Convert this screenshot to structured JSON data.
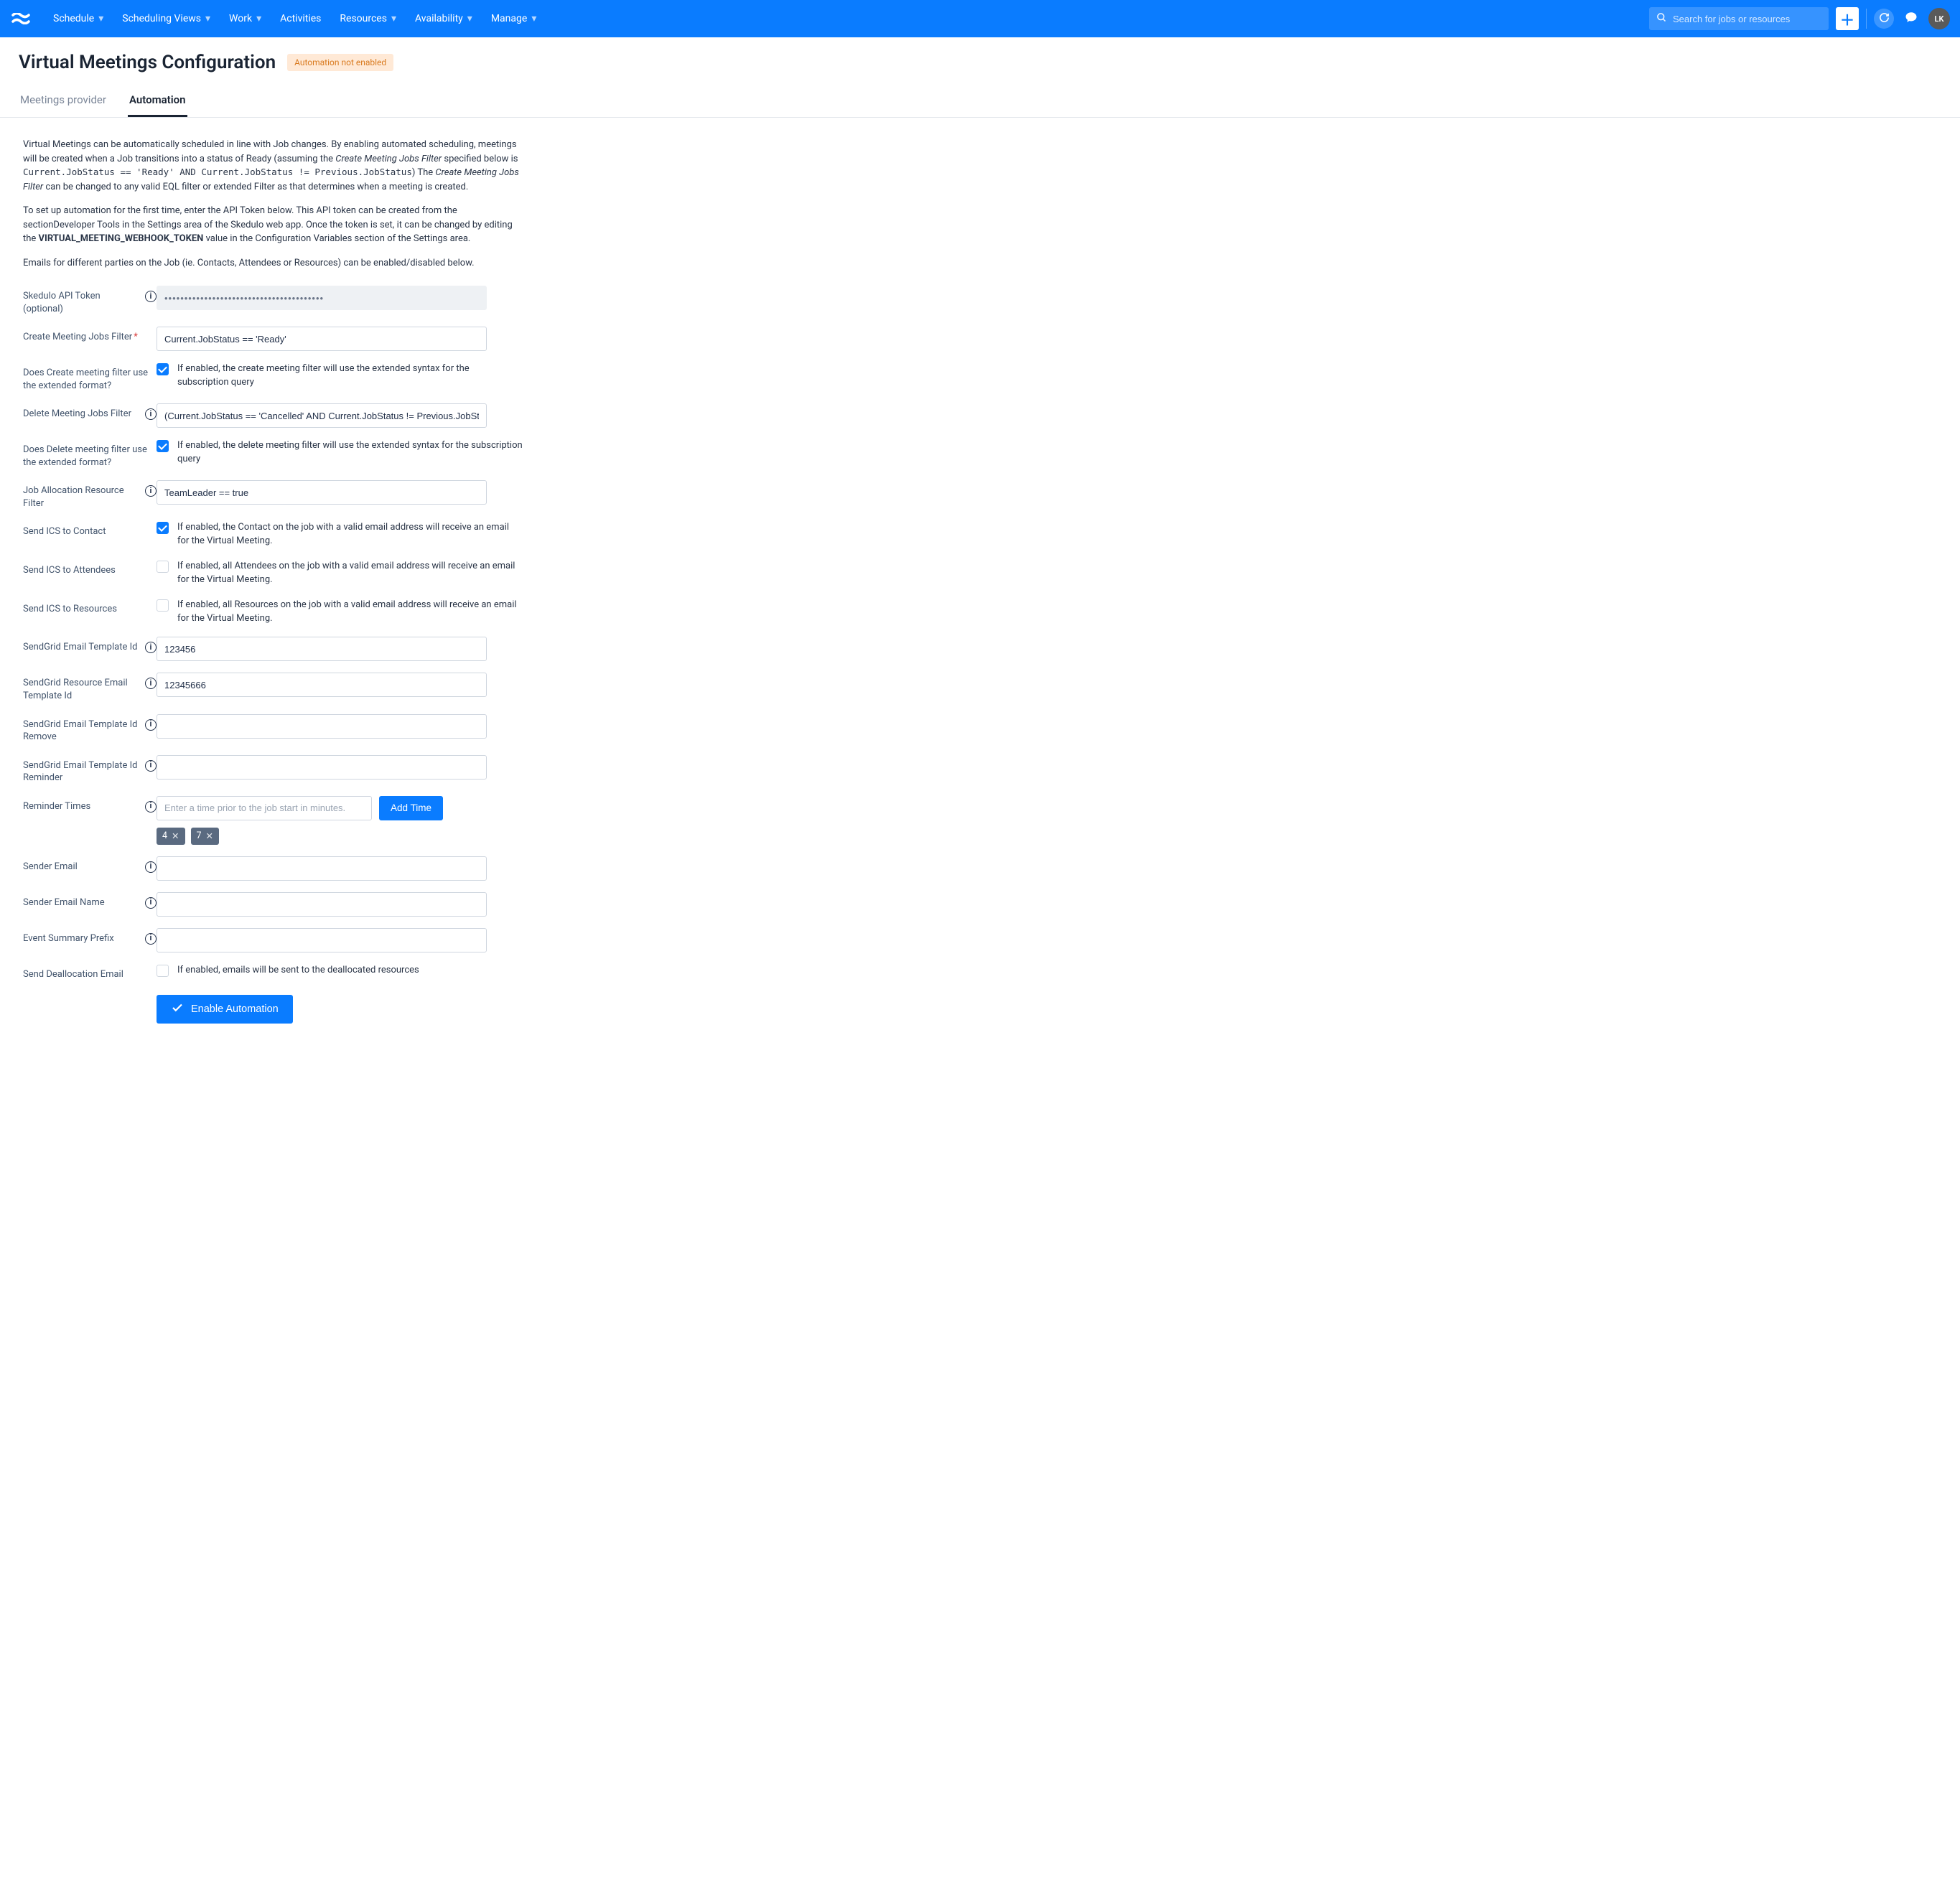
{
  "nav": {
    "items": [
      {
        "label": "Schedule",
        "caret": true
      },
      {
        "label": "Scheduling Views",
        "caret": true
      },
      {
        "label": "Work",
        "caret": true
      },
      {
        "label": "Activities",
        "caret": false
      },
      {
        "label": "Resources",
        "caret": true
      },
      {
        "label": "Availability",
        "caret": true
      },
      {
        "label": "Manage",
        "caret": true
      }
    ],
    "search_placeholder": "Search for jobs or resources",
    "avatar_initials": "LK"
  },
  "header": {
    "title": "Virtual Meetings Configuration",
    "badge": "Automation not enabled"
  },
  "tabs": [
    {
      "label": "Meetings provider",
      "active": false
    },
    {
      "label": "Automation",
      "active": true
    }
  ],
  "intro": {
    "p1_a": "Virtual Meetings can be automatically scheduled in line with Job changes. By enabling automated scheduling, meetings will be created when a Job transitions into a status of Ready (assuming the ",
    "p1_em": "Create Meeting Jobs Filter",
    "p1_b": " specified below is ",
    "p1_code": "Current.JobStatus == 'Ready' AND Current.JobStatus != Previous.JobStatus",
    "p1_c": ") The ",
    "p1_em2": "Create Meeting Jobs Filter",
    "p1_d": " can be changed to any valid EQL filter or extended Filter as that determines when a meeting is created.",
    "p2_a": "To set up automation for the first time, enter the API Token below. This API token can be created from the sectionDeveloper Tools in the Settings area of the Skedulo web app. Once the token is set, it can be changed by editing the ",
    "p2_strong": "VIRTUAL_MEETING_WEBHOOK_TOKEN",
    "p2_b": " value in the Configuration Variables section of the Settings area.",
    "p3": "Emails for different parties on the Job (ie. Contacts, Attendees or Resources) can be enabled/disabled below."
  },
  "form": {
    "api_token": {
      "label": "Skedulo API Token (optional)",
      "value": "••••••••••••••••••••••••••••••••••••••••"
    },
    "create_filter": {
      "label": "Create Meeting Jobs Filter",
      "value": "Current.JobStatus == 'Ready'"
    },
    "create_ext": {
      "label": "Does Create meeting filter use the extended format?",
      "desc": "If enabled, the create meeting filter will use the extended syntax for the subscription query",
      "checked": true
    },
    "delete_filter": {
      "label": "Delete Meeting Jobs Filter",
      "value": "(Current.JobStatus == 'Cancelled' AND Current.JobStatus != Previous.JobStatus)"
    },
    "delete_ext": {
      "label": "Does Delete meeting filter use the extended format?",
      "desc": "If enabled, the delete meeting filter will use the extended syntax for the subscription query",
      "checked": true
    },
    "alloc_filter": {
      "label": "Job Allocation Resource Filter",
      "value": "TeamLeader == true"
    },
    "ics_contact": {
      "label": "Send ICS to Contact",
      "desc": "If enabled, the Contact on the job with a valid email address will receive an email for the Virtual Meeting.",
      "checked": true
    },
    "ics_attendees": {
      "label": "Send ICS to Attendees",
      "desc": "If enabled, all Attendees on the job with a valid email address will receive an email for the Virtual Meeting.",
      "checked": false
    },
    "ics_resources": {
      "label": "Send ICS to Resources",
      "desc": "If enabled, all Resources on the job with a valid email address will receive an email for the Virtual Meeting.",
      "checked": false
    },
    "sg_template": {
      "label": "SendGrid Email Template Id",
      "value": "123456"
    },
    "sg_resource_template": {
      "label": "SendGrid Resource Email Template Id",
      "value": "12345666"
    },
    "sg_remove": {
      "label": "SendGrid Email Template Id Remove",
      "value": ""
    },
    "sg_reminder": {
      "label": "SendGrid Email Template Id Reminder",
      "value": ""
    },
    "reminder": {
      "label": "Reminder Times",
      "placeholder": "Enter a time prior to the job start in minutes.",
      "add_btn": "Add Time",
      "chips": [
        "4",
        "7"
      ]
    },
    "sender_email": {
      "label": "Sender Email",
      "value": ""
    },
    "sender_name": {
      "label": "Sender Email Name",
      "value": ""
    },
    "summary_prefix": {
      "label": "Event Summary Prefix",
      "value": ""
    },
    "dealloc": {
      "label": "Send Deallocation Email",
      "desc": "If enabled, emails will be sent to the deallocated resources",
      "checked": false
    },
    "enable_btn": "Enable Automation"
  }
}
